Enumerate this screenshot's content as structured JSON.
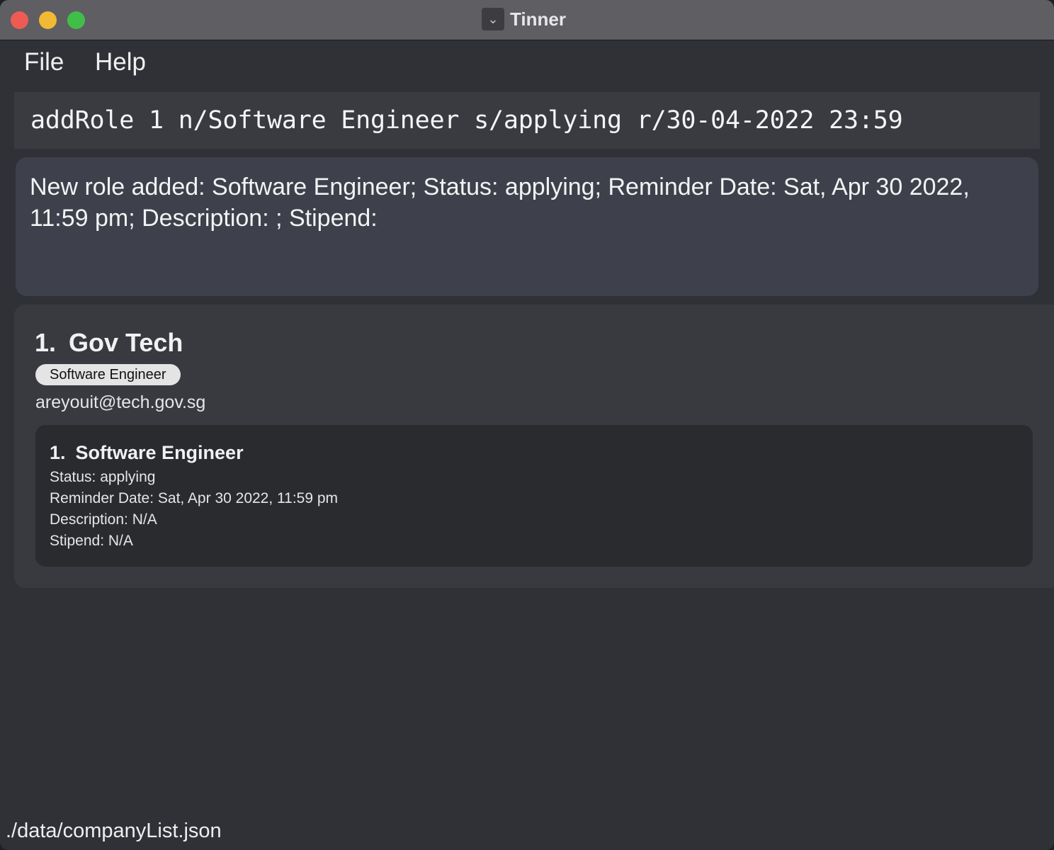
{
  "window": {
    "title": "Tinner",
    "icon": "chevron-down-icon"
  },
  "menu": {
    "file": "File",
    "help": "Help"
  },
  "command": {
    "value": "addRole 1 n/Software Engineer s/applying r/30-04-2022 23:59"
  },
  "result": {
    "text": "New role added: Software Engineer; Status: applying; Reminder Date: Sat, Apr 30 2022,\n11:59 pm; Description: ; Stipend:"
  },
  "companies": [
    {
      "index": "1.",
      "name": "Gov Tech",
      "tags": [
        "Software Engineer"
      ],
      "email": "areyouit@tech.gov.sg",
      "roles": [
        {
          "index": "1.",
          "name": "Software Engineer",
          "status": "Status: applying",
          "reminder": "Reminder Date: Sat, Apr 30 2022, 11:59 pm",
          "description": "Description: N/A",
          "stipend": "Stipend: N/A"
        }
      ]
    }
  ],
  "status_bar": {
    "path": "./data/companyList.json"
  },
  "colors": {
    "close": "#ee5b53",
    "minimize": "#f2b934",
    "maximize": "#3fbf48",
    "background": "#303136",
    "result_panel": "#3e414b"
  }
}
